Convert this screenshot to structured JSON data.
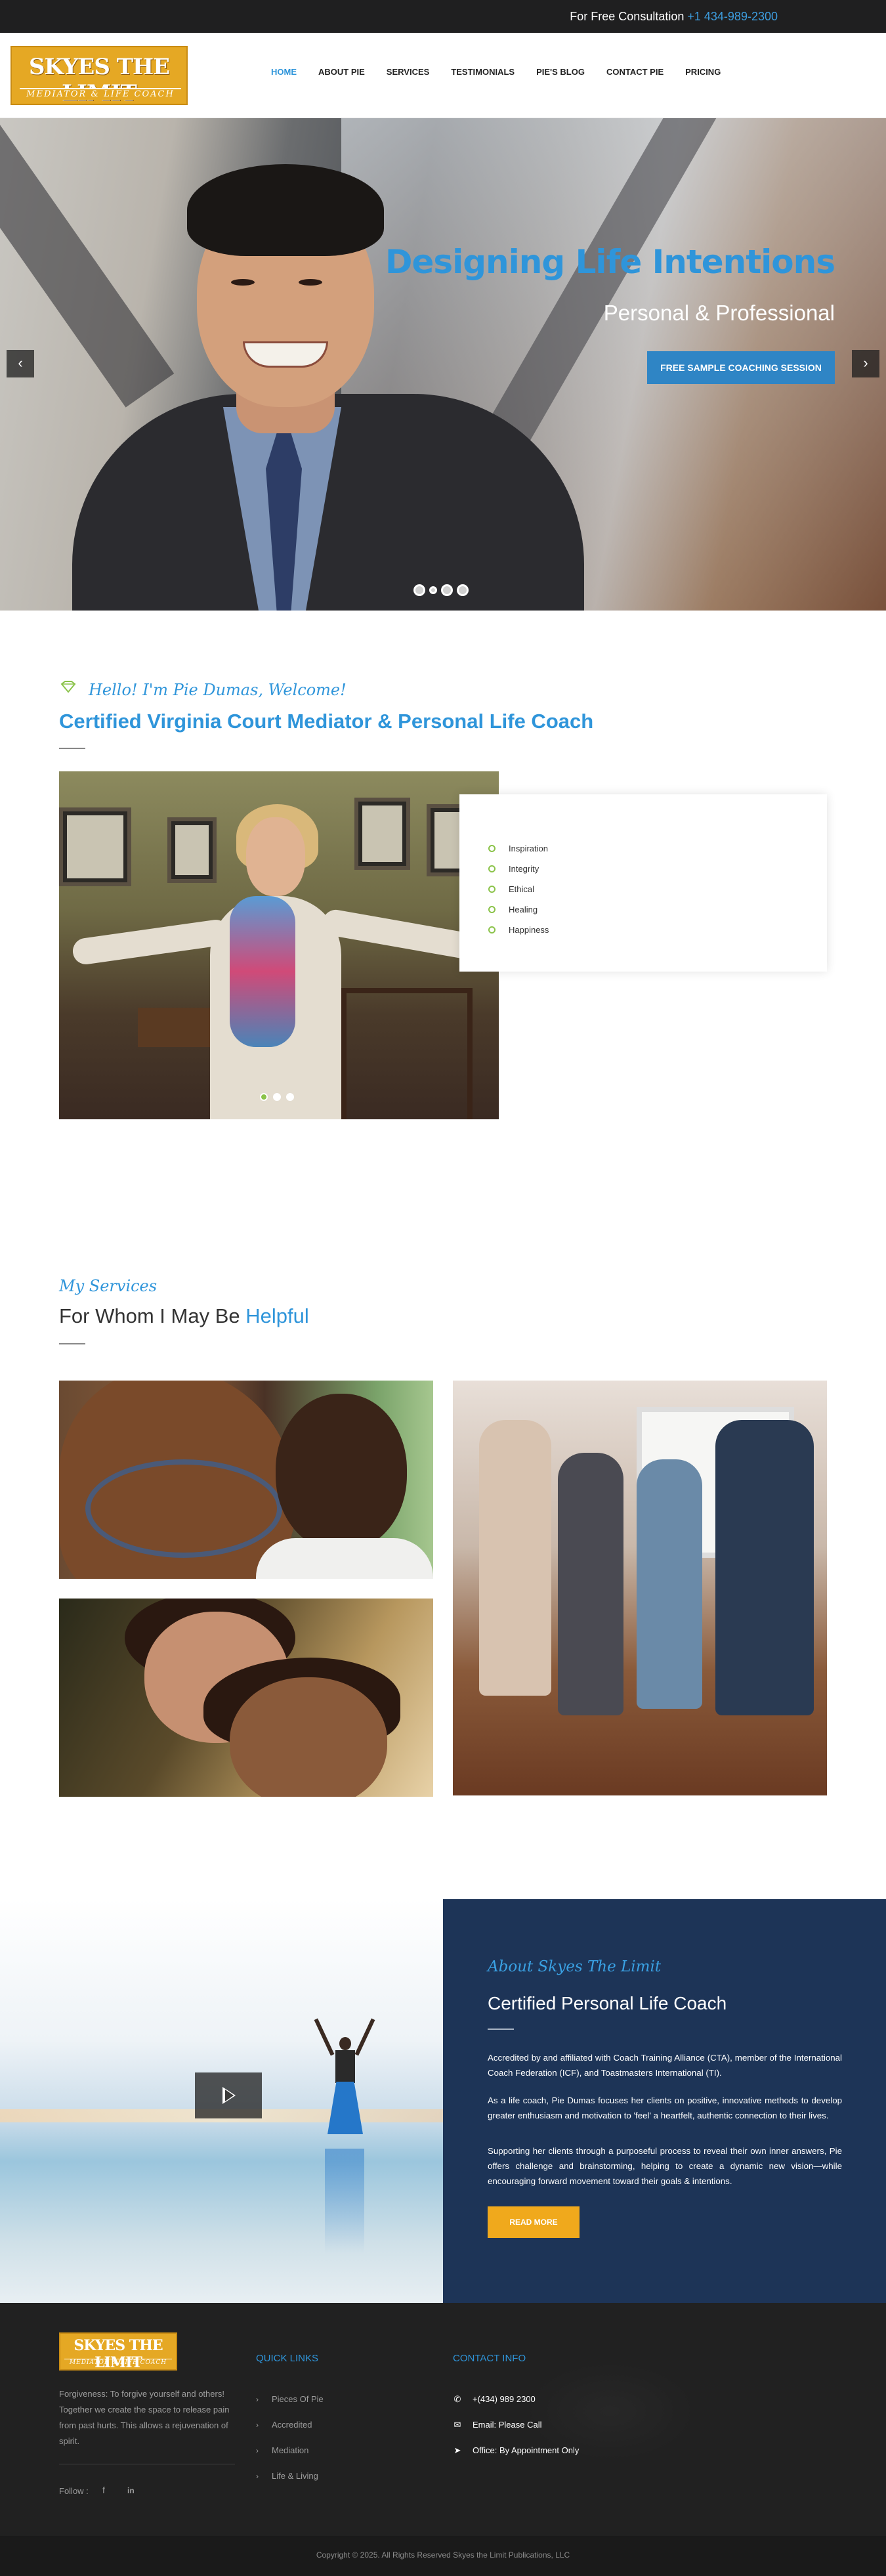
{
  "topbar": {
    "consult_label": "For Free Consultation",
    "phone": "+1 434-989-2300"
  },
  "brand": {
    "logo_main": "SKYES THE LIMIT",
    "logo_sub": "MEDIATOR & LIFE COACH"
  },
  "nav": {
    "items": [
      {
        "label": "HOME",
        "active": true
      },
      {
        "label": "ABOUT PIE"
      },
      {
        "label": "SERVICES"
      },
      {
        "label": "TESTIMONIALS"
      },
      {
        "label": "PIE'S BLOG"
      },
      {
        "label": "CONTACT PIE"
      },
      {
        "label": "PRICING"
      }
    ]
  },
  "hero": {
    "title": "Designing Life Intentions",
    "subtitle": "Personal & Professional",
    "cta": "FREE SAMPLE COACHING SESSION",
    "prev_icon": "‹",
    "next_icon": "›",
    "slide_count": 4
  },
  "welcome": {
    "greeting": "Hello! I'm Pie Dumas, Welcome!",
    "heading": "Certified Virginia Court Mediator & Personal Life Coach",
    "values": [
      "Inspiration",
      "Integrity",
      "Ethical",
      "Healing",
      "Happiness"
    ],
    "slide_count": 3
  },
  "services": {
    "subtitle": "My Services",
    "heading_prefix": "For Whom I May Be",
    "heading_highlight": "Helpful"
  },
  "about": {
    "subtitle": "About Skyes The Limit",
    "heading": "Certified Personal Life Coach",
    "paragraphs": [
      "Accredited by and affiliated with Coach Training Alliance (CTA), member of the International Coach Federation (ICF), and Toastmasters International (TI).",
      "As a life coach, Pie Dumas focuses her clients on positive, innovative methods to develop greater enthusiasm and motivation to 'feel' a heartfelt, authentic connection to their lives.",
      "Supporting her clients through a purposeful process to reveal their own inner answers, Pie offers challenge and brainstorming, helping to create a dynamic new vision—while encouraging forward movement toward their goals & intentions."
    ],
    "button": "READ MORE"
  },
  "footer": {
    "logo_main": "SKYES THE LIMIT",
    "logo_sub": "MEDIATOR & LIFE COACH",
    "blurb": "Forgiveness: To forgive yourself and others! Together we create the space to release pain from past hurts. This allows a rejuvenation of spirit.",
    "follow_label": "Follow :",
    "social": {
      "facebook": "f",
      "linkedin": "in"
    },
    "quick_links_title": "QUICK LINKS",
    "quick_links": [
      "Pieces Of Pie",
      "Accredited",
      "Mediation",
      "Life & Living"
    ],
    "contact_title": "CONTACT INFO",
    "contacts": [
      {
        "icon": "phone-icon",
        "glyph": "✆",
        "text": "+(434) 989 2300"
      },
      {
        "icon": "envelope-icon",
        "glyph": "✉",
        "text": "Email: Please Call"
      },
      {
        "icon": "location-arrow-icon",
        "glyph": "➤",
        "text": "Office: By Appointment Only"
      }
    ]
  },
  "copyright": "Copyright © 2025. All Rights Reserved Skyes the Limit Publications, LLC",
  "colors": {
    "accent_blue": "#2f95da",
    "navy": "#1d3457",
    "gold": "#e5a824",
    "green": "#8bc34a",
    "dark": "#212121"
  }
}
